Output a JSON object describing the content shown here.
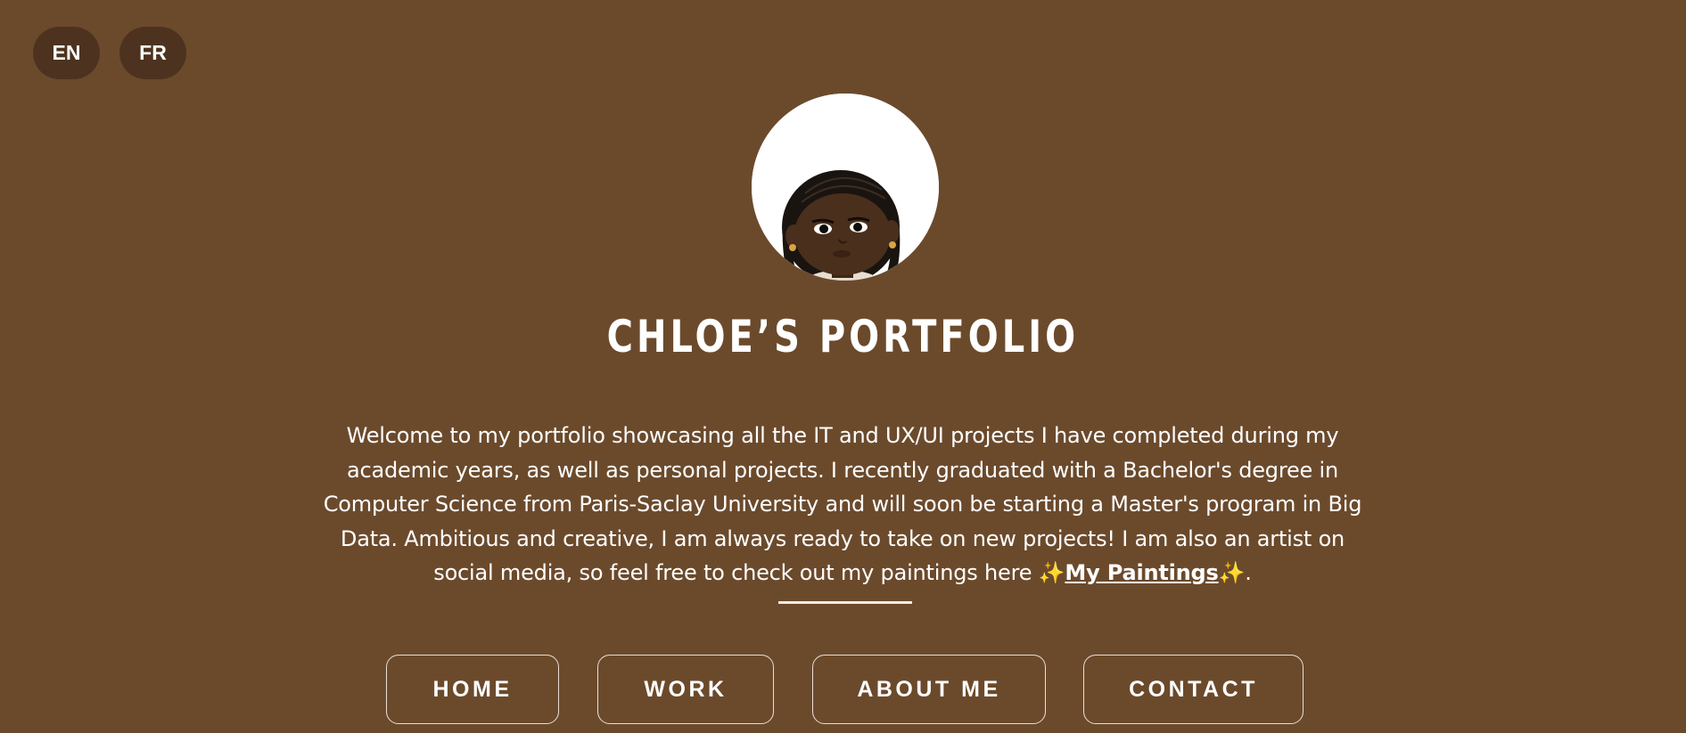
{
  "language_switch": {
    "en": "EN",
    "fr": "FR"
  },
  "header": {
    "title": "CHLOE’S PORTFOLIO"
  },
  "intro": {
    "text": "Welcome to my portfolio showcasing all the IT and UX/UI projects I have completed during my academic years, as well as personal projects. I recently graduated with a Bachelor's degree in Computer Science from Paris-Saclay University and will soon be starting a Master's program in Big Data. Ambitious and creative, I am always ready to take on new projects! I am also an artist on social media, so feel free to check out my paintings here ",
    "sparkle": "✨",
    "link_label": "My Paintings",
    "end": "."
  },
  "nav": {
    "home": "HOME",
    "work": "WORK",
    "about": "ABOUT ME",
    "contact": "CONTACT"
  },
  "colors": {
    "background": "#6b4a2c",
    "button_dark": "#4d331f",
    "text": "#ffffff"
  }
}
